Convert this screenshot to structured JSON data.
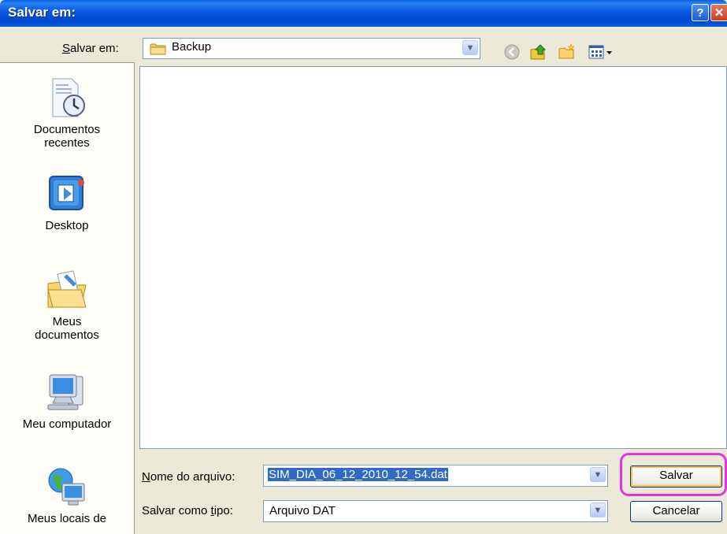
{
  "window": {
    "title": "Salvar em:",
    "help_glyph": "?",
    "close_glyph": "✕"
  },
  "location": {
    "label": "Salvar em:",
    "value": "Backup"
  },
  "toolbar": {
    "icons": [
      "back-icon",
      "up-folder-icon",
      "new-folder-icon",
      "view-menu-icon"
    ]
  },
  "places": [
    {
      "label_line1": "Documentos",
      "label_line2": "recentes",
      "icon": "recent-documents-icon"
    },
    {
      "label_line1": "Desktop",
      "label_line2": "",
      "icon": "desktop-icon"
    },
    {
      "label_line1": "Meus",
      "label_line2": "documentos",
      "icon": "my-documents-icon"
    },
    {
      "label_line1": "Meu computador",
      "label_line2": "",
      "icon": "my-computer-icon"
    },
    {
      "label_line1": "Meus locais de",
      "label_line2": "",
      "icon": "network-places-icon"
    }
  ],
  "filename": {
    "label": "Nome do arquivo:",
    "value": "SIM_DIA_06_12_2010_12_54.dat"
  },
  "filetype": {
    "label": "Salvar como tipo:",
    "value": "Arquivo DAT"
  },
  "buttons": {
    "save": "Salvar",
    "cancel": "Cancelar"
  },
  "colors": {
    "highlight": "#E434E0",
    "selection": "#316AC5",
    "titlebar": "#0A5FE6"
  }
}
